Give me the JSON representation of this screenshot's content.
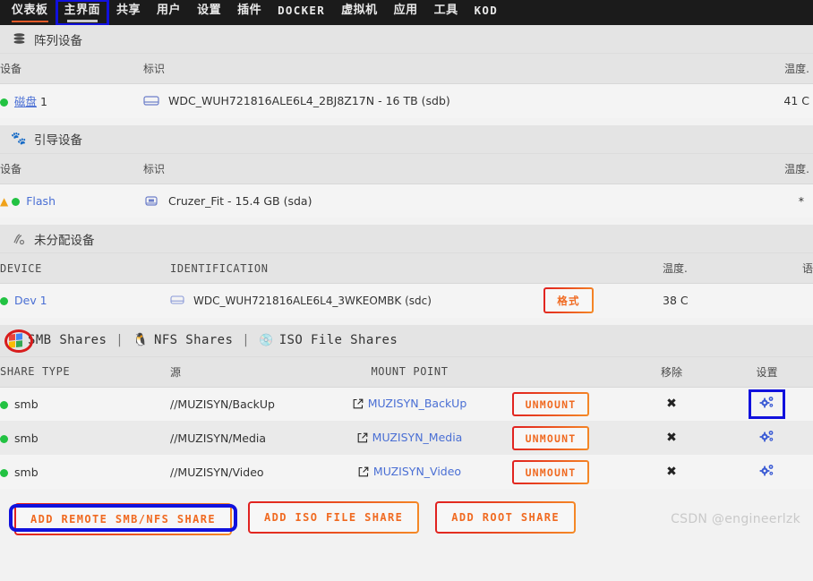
{
  "nav": {
    "items": [
      {
        "label": "仪表板",
        "active_underline": "orange",
        "boxed": false,
        "latin": false
      },
      {
        "label": "主界面",
        "active_underline": "white",
        "boxed": true,
        "latin": false
      },
      {
        "label": "共享",
        "active_underline": "none",
        "boxed": false,
        "latin": false
      },
      {
        "label": "用户",
        "active_underline": "none",
        "boxed": false,
        "latin": false
      },
      {
        "label": "设置",
        "active_underline": "none",
        "boxed": false,
        "latin": false
      },
      {
        "label": "插件",
        "active_underline": "none",
        "boxed": false,
        "latin": false
      },
      {
        "label": "DOCKER",
        "active_underline": "none",
        "boxed": false,
        "latin": true
      },
      {
        "label": "虚拟机",
        "active_underline": "none",
        "boxed": false,
        "latin": false
      },
      {
        "label": "应用",
        "active_underline": "none",
        "boxed": false,
        "latin": false
      },
      {
        "label": "工具",
        "active_underline": "none",
        "boxed": false,
        "latin": false
      },
      {
        "label": "KOD",
        "active_underline": "none",
        "boxed": false,
        "latin": true
      }
    ]
  },
  "array_devices": {
    "title": "阵列设备",
    "icon": "database-icon",
    "columns": {
      "device": "设备",
      "identification": "标识",
      "temp": "温度."
    },
    "rows": [
      {
        "status": "online",
        "name": "磁盘",
        "index": "1",
        "identification": "WDC_WUH721816ALE6L4_2BJ8Z17N - 16 TB (sdb)",
        "temp": "41 C"
      }
    ]
  },
  "boot_device": {
    "title": "引导设备",
    "icon": "paw-icon",
    "columns": {
      "device": "设备",
      "identification": "标识",
      "temp": "温度."
    },
    "rows": [
      {
        "warning": true,
        "status": "online",
        "name": "Flash",
        "identification": "Cruzer_Fit - 15.4 GB (sda)",
        "temp": "*"
      }
    ]
  },
  "unassigned_devices": {
    "title": "未分配设备",
    "icon": "unassigned-icon",
    "columns": {
      "device": "DEVICE",
      "identification": "IDENTIFICATION",
      "temp": "温度.",
      "extra": "语"
    },
    "rows": [
      {
        "status": "online",
        "name": "Dev 1",
        "identification": "WDC_WUH721816ALE6L4_3WKEOMBK (sdc)",
        "action_label": "格式",
        "temp": "38 C"
      }
    ]
  },
  "share_tabs": {
    "smb": {
      "label": "SMB Shares",
      "icon": "windows-icon"
    },
    "nfs": {
      "label": "NFS Shares",
      "icon": "linux-penguin-icon"
    },
    "iso": {
      "label": "ISO File Shares",
      "icon": "disc-icon"
    },
    "separator": "|"
  },
  "shares_table": {
    "columns": {
      "share_type": "SHARE TYPE",
      "source": "源",
      "mount_point": "MOUNT POINT",
      "action": "",
      "remove": "移除",
      "settings": "设置"
    },
    "rows": [
      {
        "status": "online",
        "share_type": "smb",
        "source": "//MUZISYN/BackUp",
        "mount_point": "MUZISYN_BackUp",
        "action_label": "UNMOUNT",
        "remove_glyph": "✖",
        "settings_icon": "cogs-icon",
        "settings_highlighted": true
      },
      {
        "status": "online",
        "share_type": "smb",
        "source": "//MUZISYN/Media",
        "mount_point": "MUZISYN_Media",
        "action_label": "UNMOUNT",
        "remove_glyph": "✖",
        "settings_icon": "cogs-icon",
        "settings_highlighted": false
      },
      {
        "status": "online",
        "share_type": "smb",
        "source": "//MUZISYN/Video",
        "mount_point": "MUZISYN_Video",
        "action_label": "UNMOUNT",
        "remove_glyph": "✖",
        "settings_icon": "cogs-icon",
        "settings_highlighted": false
      }
    ]
  },
  "bottom_buttons": [
    {
      "label": "ADD REMOTE SMB/NFS SHARE",
      "highlighted": true
    },
    {
      "label": "ADD ISO FILE SHARE",
      "highlighted": false
    },
    {
      "label": "ADD ROOT SHARE",
      "highlighted": false
    }
  ],
  "watermark": "CSDN @engineerlzk",
  "colors": {
    "nav_bg": "#1b1b1b",
    "accent_orange": "#f06a21",
    "accent_red": "#e02020",
    "highlight_blue": "#1111dd",
    "annotation_red": "#d81c1c",
    "link_blue": "#4a6fd4",
    "status_green": "#22c242",
    "warning_amber": "#f0a21a"
  }
}
